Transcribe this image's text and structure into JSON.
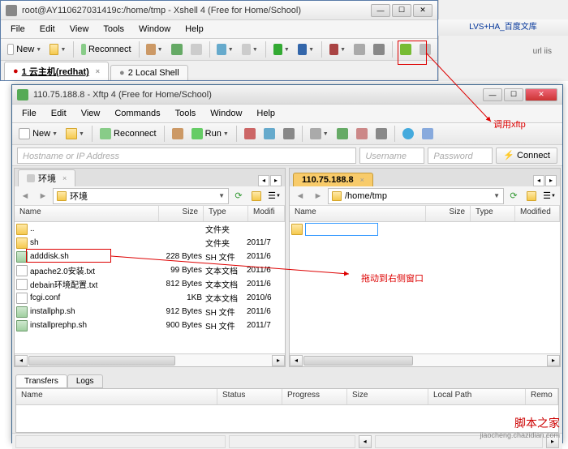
{
  "bg": {
    "tab": "LVS+HA_百度文库",
    "fields": "url    iis"
  },
  "xshell": {
    "title": "root@AY110627031419c:/home/tmp - Xshell 4 (Free for Home/School)",
    "menu": [
      "File",
      "Edit",
      "View",
      "Tools",
      "Window",
      "Help"
    ],
    "new_label": "New",
    "reconnect_label": "Reconnect",
    "tabs": [
      {
        "label": "1 云主机(redhat)",
        "active": true
      },
      {
        "label": "2 Local Shell",
        "active": false
      }
    ]
  },
  "xftp": {
    "title": "110.75.188.8 - Xftp 4 (Free for Home/School)",
    "menu": [
      "File",
      "Edit",
      "View",
      "Commands",
      "Tools",
      "Window",
      "Help"
    ],
    "new_label": "New",
    "reconnect_label": "Reconnect",
    "run_label": "Run",
    "addr": {
      "placeholder": "Hostname or IP Address",
      "user_ph": "Username",
      "pass_ph": "Password",
      "connect": "Connect"
    },
    "left": {
      "tab": "环境",
      "path": "环境",
      "cols": {
        "name": "Name",
        "size": "Size",
        "type": "Type",
        "mod": "Modifi"
      },
      "rows": [
        {
          "icon": "folder",
          "name": "..",
          "size": "",
          "type": "文件夹",
          "mod": ""
        },
        {
          "icon": "folder",
          "name": "sh",
          "size": "",
          "type": "文件夹",
          "mod": "2011/7"
        },
        {
          "icon": "sh",
          "name": "adddisk.sh",
          "size": "228 Bytes",
          "type": "SH 文件",
          "mod": "2011/6"
        },
        {
          "icon": "file",
          "name": "apache2.0安装.txt",
          "size": "99 Bytes",
          "type": "文本文档",
          "mod": "2011/6"
        },
        {
          "icon": "file",
          "name": "debain环境配置.txt",
          "size": "812 Bytes",
          "type": "文本文档",
          "mod": "2011/6"
        },
        {
          "icon": "file",
          "name": "fcgi.conf",
          "size": "1KB",
          "type": "文本文档",
          "mod": "2010/6"
        },
        {
          "icon": "sh",
          "name": "installphp.sh",
          "size": "912 Bytes",
          "type": "SH 文件",
          "mod": "2011/6"
        },
        {
          "icon": "sh",
          "name": "installprephp.sh",
          "size": "900 Bytes",
          "type": "SH 文件",
          "mod": "2011/7"
        }
      ]
    },
    "right": {
      "tab": "110.75.188.8",
      "path": "/home/tmp",
      "cols": {
        "name": "Name",
        "size": "Size",
        "type": "Type",
        "mod": "Modified"
      },
      "rename_value": ""
    },
    "bottom": {
      "tabs": [
        "Transfers",
        "Logs"
      ],
      "cols": {
        "name": "Name",
        "status": "Status",
        "prog": "Progress",
        "size": "Size",
        "lp": "Local Path",
        "remo": "Remo"
      }
    }
  },
  "anno": {
    "a1": "调用xftp",
    "a2": "拖动到右侧窗口"
  },
  "watermark": {
    "w1": "脚本之家",
    "w2": "jiaocheng.chazidian.com"
  }
}
